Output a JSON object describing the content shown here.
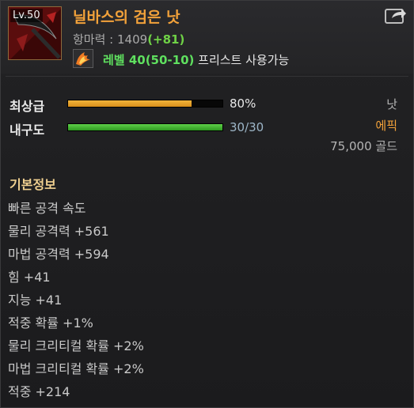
{
  "item": {
    "level_badge": "Lv.50",
    "name": "닐바스의 검은 낫",
    "attack_label": "항마력 : ",
    "attack_value": "1409",
    "attack_bonus": "(+81)",
    "required_level": "레벨 40(50-10)",
    "required_class": " 프리스트 사용가능",
    "icons": {
      "item": "black-scythe-icon",
      "class": "phoenix-class-icon",
      "share": "share-link-icon"
    }
  },
  "stats_bars": {
    "quality_label": "최상급",
    "quality_value": "80%",
    "quality_fraction": 0.8,
    "durability_label": "내구도",
    "durability_value": "30/30",
    "durability_fraction": 1.0
  },
  "meta": {
    "type": "낫",
    "grade": "에픽",
    "price": "75,000 골드"
  },
  "basic_info": {
    "title": "기본정보",
    "lines": [
      "빠른 공격 속도",
      "물리 공격력 +561",
      "마법 공격력 +594",
      "힘 +41",
      "지능 +41",
      "적중 확률 +1%",
      "물리 크리티컬 확률 +2%",
      "마법 크리티컬 확률 +2%",
      "적중 +214"
    ]
  },
  "colors": {
    "name": "#f3a23a",
    "quality_bar": "#e8a62a",
    "durability_bar": "#3fb52c",
    "bonus": "#6fd146",
    "level_requirement": "#5fe05f"
  }
}
